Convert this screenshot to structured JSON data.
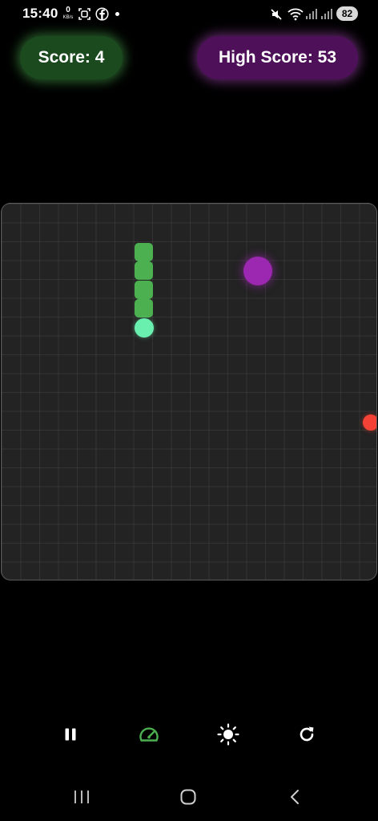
{
  "status_bar": {
    "time": "15:40",
    "net_speed_value": "0",
    "net_speed_unit": "KB/s",
    "battery": "82"
  },
  "scores": {
    "score_label": "Score: 4",
    "high_score_label": "High Score: 53"
  },
  "colors": {
    "snake_body": "#4caf50",
    "snake_head": "#69f0ae",
    "food_purple": "#9c27b0",
    "food_red": "#f44336",
    "score_accent": "#4caf50",
    "high_score_accent": "#ab47bc",
    "speed_icon_active": "#4caf50"
  },
  "controls": [
    {
      "name": "pause-button",
      "icon": "pause-icon"
    },
    {
      "name": "speed-button",
      "icon": "speedometer-icon"
    },
    {
      "name": "theme-button",
      "icon": "brightness-icon"
    },
    {
      "name": "restart-button",
      "icon": "refresh-icon"
    }
  ],
  "nav_bar": [
    "recent-apps-icon",
    "home-icon",
    "back-icon"
  ]
}
